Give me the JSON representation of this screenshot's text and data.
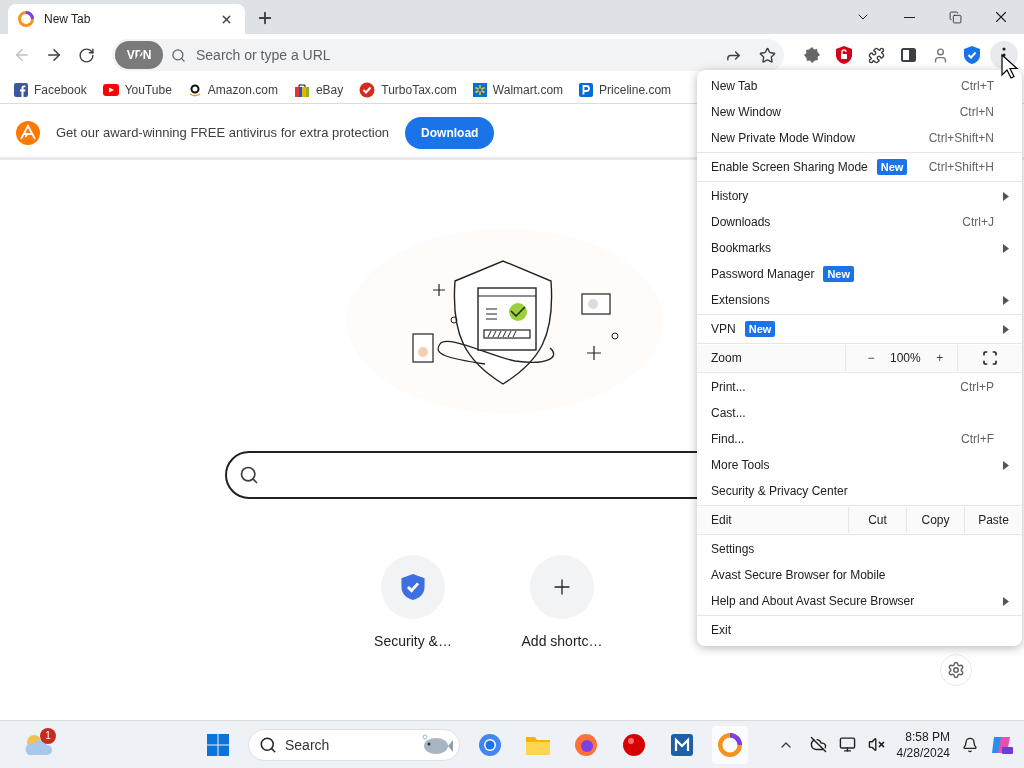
{
  "tab": {
    "title": "New Tab"
  },
  "address_bar": {
    "vpn_label": "VPN",
    "placeholder": "Search or type a URL"
  },
  "bookmarks": [
    {
      "label": "Facebook"
    },
    {
      "label": "YouTube"
    },
    {
      "label": "Amazon.com"
    },
    {
      "label": "eBay"
    },
    {
      "label": "TurboTax.com"
    },
    {
      "label": "Walmart.com"
    },
    {
      "label": "Priceline.com"
    }
  ],
  "banner": {
    "message": "Get our award-winning FREE antivirus for extra protection",
    "button": "Download"
  },
  "shortcuts": [
    {
      "label": "Security &…"
    },
    {
      "label": "Add shortc…"
    }
  ],
  "menu": {
    "groups": [
      {
        "items": [
          {
            "kind": "item",
            "label": "New Tab",
            "shortcut": "Ctrl+T",
            "submenu": false
          },
          {
            "kind": "item",
            "label": "New Window",
            "shortcut": "Ctrl+N",
            "submenu": false
          },
          {
            "kind": "item",
            "label": "New Private Mode Window",
            "shortcut": "Ctrl+Shift+N",
            "submenu": false
          }
        ]
      },
      {
        "items": [
          {
            "kind": "item",
            "label": "Enable Screen Sharing Mode",
            "badge": "New",
            "shortcut": "Ctrl+Shift+H",
            "submenu": false
          }
        ]
      },
      {
        "items": [
          {
            "kind": "item",
            "label": "History",
            "submenu": true
          },
          {
            "kind": "item",
            "label": "Downloads",
            "shortcut": "Ctrl+J",
            "submenu": false
          },
          {
            "kind": "item",
            "label": "Bookmarks",
            "submenu": true
          },
          {
            "kind": "item",
            "label": "Password Manager",
            "badge": "New",
            "submenu": false
          },
          {
            "kind": "item",
            "label": "Extensions",
            "submenu": true
          }
        ]
      },
      {
        "items": [
          {
            "kind": "item",
            "label": "VPN",
            "badge": "New",
            "submenu": true
          }
        ]
      },
      {
        "items": [
          {
            "kind": "zoom",
            "label": "Zoom",
            "minus": "−",
            "value": "100%",
            "plus": "+"
          }
        ]
      },
      {
        "items": [
          {
            "kind": "item",
            "label": "Print...",
            "shortcut": "Ctrl+P",
            "submenu": false
          },
          {
            "kind": "item",
            "label": "Cast...",
            "submenu": false
          },
          {
            "kind": "item",
            "label": "Find...",
            "shortcut": "Ctrl+F",
            "submenu": false
          },
          {
            "kind": "item",
            "label": "More Tools",
            "submenu": true
          },
          {
            "kind": "item",
            "label": "Security & Privacy Center",
            "submenu": false
          }
        ]
      },
      {
        "items": [
          {
            "kind": "edit",
            "label": "Edit",
            "actions": [
              "Cut",
              "Copy",
              "Paste"
            ]
          }
        ]
      },
      {
        "items": [
          {
            "kind": "item",
            "label": "Settings",
            "submenu": false
          },
          {
            "kind": "item",
            "label": "Avast Secure Browser for Mobile",
            "submenu": false
          },
          {
            "kind": "item",
            "label": "Help and About Avast Secure Browser",
            "submenu": true
          }
        ]
      },
      {
        "items": [
          {
            "kind": "item",
            "label": "Exit",
            "submenu": false
          }
        ]
      }
    ]
  },
  "taskbar": {
    "weather_badge": "1",
    "search_placeholder": "Search",
    "time": "8:58 PM",
    "date": "4/28/2024"
  }
}
